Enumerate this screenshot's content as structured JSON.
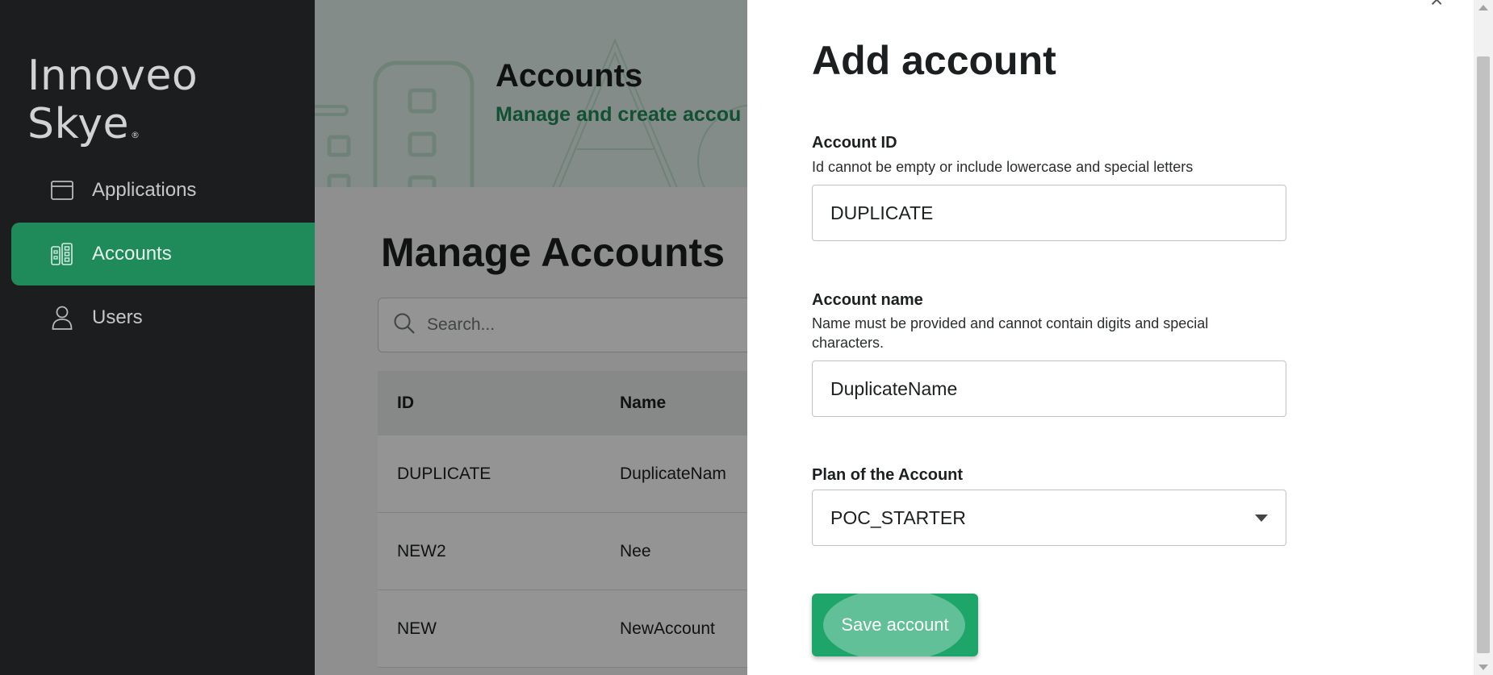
{
  "brand": {
    "name": "Innoveo Skye",
    "mark": "®"
  },
  "sidebar": {
    "items": [
      {
        "label": "Applications",
        "icon": "window-icon",
        "active": false
      },
      {
        "label": "Accounts",
        "icon": "building-icon",
        "active": true
      },
      {
        "label": "Users",
        "icon": "user-icon",
        "active": false
      }
    ]
  },
  "hero": {
    "title": "Accounts",
    "subtitle": "Manage and create accou"
  },
  "main": {
    "title": "Manage Accounts",
    "search_placeholder": "Search...",
    "table": {
      "headers": [
        "ID",
        "Name"
      ],
      "rows": [
        [
          "DUPLICATE",
          "DuplicateNam"
        ],
        [
          "NEW2",
          "Nee"
        ],
        [
          "NEW",
          "NewAccount"
        ]
      ]
    }
  },
  "drawer": {
    "title": "Add account",
    "close_icon": "close-icon",
    "account_id": {
      "label": "Account ID",
      "help": "Id cannot be empty or include lowercase and special letters",
      "value": "DUPLICATE"
    },
    "account_name": {
      "label": "Account name",
      "help": "Name must be provided and cannot contain digits and special characters.",
      "value": "DuplicateName"
    },
    "plan": {
      "label": "Plan of the Account",
      "value": "POC_STARTER"
    },
    "save_label": "Save account"
  },
  "colors": {
    "sidebar_bg": "#1b1d1e",
    "accent": "#1f8a5a",
    "button": "#1ea56a"
  }
}
